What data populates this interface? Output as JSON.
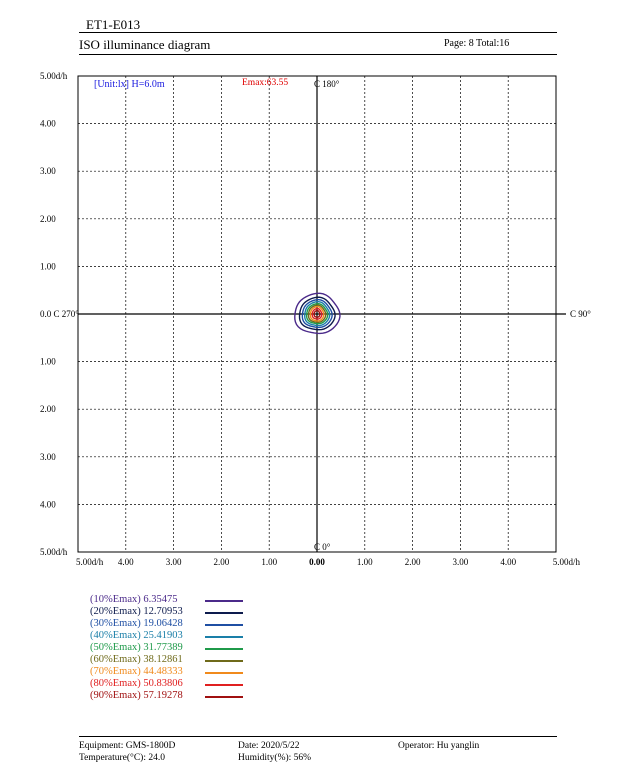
{
  "header": {
    "report_id": "ET1-E013",
    "title": "ISO illuminance diagram",
    "page_label": "Page: 8  Total:16"
  },
  "chart_data": {
    "type": "contour",
    "unit_label": "[Unit:lx]  H=6.0m",
    "emax_label": "Emax:63.55",
    "emax": 63.55,
    "xlim": [
      -5,
      5
    ],
    "ylim": [
      -5,
      5
    ],
    "grid": true,
    "x_tick_labels": [
      "5.00d/h",
      "4.00",
      "3.00",
      "2.00",
      "1.00",
      "0.00",
      "1.00",
      "2.00",
      "3.00",
      "4.00",
      "5.00d/h"
    ],
    "y_tick_labels": [
      "5.00d/h",
      "4.00",
      "3.00",
      "2.00",
      "1.00",
      "0.0 C 270°",
      "1.00",
      "2.00",
      "3.00",
      "4.00",
      "5.00d/h"
    ],
    "axis_labels": {
      "c0": "C 0°",
      "c90": "C 90°",
      "c180": "C 180°"
    },
    "series": [
      {
        "name": "(10%Emax) 6.35475",
        "percent": 10,
        "value": 6.35475,
        "color": "#4b2a8a",
        "radius": [
          0.47,
          0.42
        ]
      },
      {
        "name": "(20%Emax) 12.70953",
        "percent": 20,
        "value": 12.70953,
        "color": "#0d1b4d",
        "radius": [
          0.37,
          0.34
        ]
      },
      {
        "name": "(30%Emax) 19.06428",
        "percent": 30,
        "value": 19.06428,
        "color": "#1f4fa3",
        "radius": [
          0.31,
          0.29
        ]
      },
      {
        "name": "(40%Emax) 25.41903",
        "percent": 40,
        "value": 25.41903,
        "color": "#1a7fa8",
        "radius": [
          0.26,
          0.25
        ]
      },
      {
        "name": "(50%Emax) 31.77389",
        "percent": 50,
        "value": 31.77389,
        "color": "#1f9a4a",
        "radius": [
          0.22,
          0.21
        ]
      },
      {
        "name": "(60%Emax) 38.12861",
        "percent": 60,
        "value": 38.12861,
        "color": "#6f6a1a",
        "radius": [
          0.18,
          0.18
        ]
      },
      {
        "name": "(70%Emax) 44.48333",
        "percent": 70,
        "value": 44.48333,
        "color": "#f08a1c",
        "radius": [
          0.14,
          0.15
        ]
      },
      {
        "name": "(80%Emax) 50.83806",
        "percent": 80,
        "value": 50.83806,
        "color": "#e02020",
        "radius": [
          0.1,
          0.11
        ]
      },
      {
        "name": "(90%Emax) 57.19278",
        "percent": 90,
        "value": 57.19278,
        "color": "#a01010",
        "radius": [
          0.06,
          0.07
        ]
      }
    ]
  },
  "footer": {
    "equipment": "Equipment: GMS-1800D",
    "temperature": "Temperature(°C): 24.0",
    "date": "Date: 2020/5/22",
    "humidity": "Humidity(%): 56%",
    "operator": "Operator: Hu yanglin"
  }
}
